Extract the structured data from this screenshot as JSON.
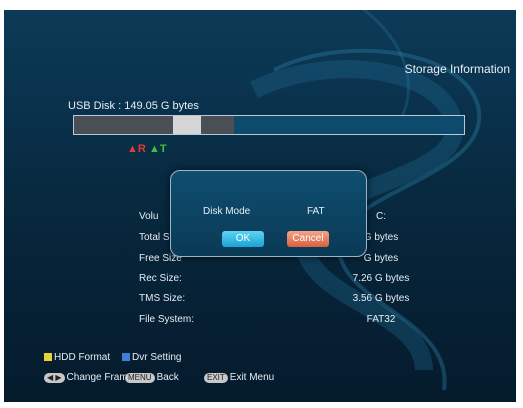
{
  "screen": {
    "title": "Storage Information",
    "disk_label": "USB Disk : 149.05 G bytes",
    "markers": {
      "rec": "R",
      "tms": "T"
    },
    "usage": {
      "rec_fraction": 0.255,
      "tms_fraction": 0.071,
      "other_fraction": 0.084
    }
  },
  "info": [
    {
      "label": "Volu",
      "value": "C:"
    },
    {
      "label": "Total S",
      "value": "G bytes"
    },
    {
      "label": "Free Size",
      "value": "G bytes"
    },
    {
      "label": "Rec Size:",
      "value": "7.26 G bytes"
    },
    {
      "label": "TMS Size:",
      "value": "3.56 G bytes"
    },
    {
      "label": "File System:",
      "value": "FAT32"
    }
  ],
  "dialog": {
    "label": "Disk Mode",
    "value": "FAT",
    "ok": "OK",
    "cancel": "Cancel"
  },
  "legend": {
    "yellow": {
      "label": "HDD Format",
      "color": "#e8d23a"
    },
    "blue": {
      "label": "Dvr Setting",
      "color": "#3d7fd8"
    },
    "change": {
      "key": "◀ ▶",
      "label": "Change Fram"
    },
    "menu": {
      "key": "MENU",
      "label": "Back"
    },
    "exit": {
      "key": "EXIT",
      "label": "Exit Menu"
    }
  }
}
